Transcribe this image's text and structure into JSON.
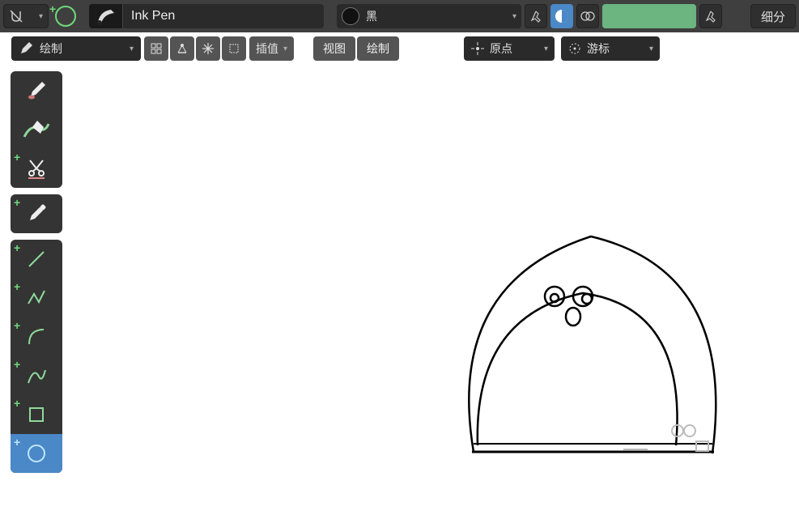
{
  "header": {
    "brush_name": "Ink Pen",
    "material_name": "黑",
    "detail_label": "细分"
  },
  "secondbar": {
    "mode_label": "绘制",
    "interpolate_label": "插值",
    "menu_view": "视图",
    "menu_draw": "绘制",
    "pivot_origin": "原点",
    "pivot_cursor": "游标"
  },
  "tools": {
    "draw": "draw-brush",
    "fill": "fill-bucket",
    "cutter": "cutter",
    "eyedropper": "eyedropper",
    "line": "line",
    "polyline": "polyline",
    "arc": "arc",
    "curve": "curve",
    "box": "box",
    "circle": "circle"
  }
}
